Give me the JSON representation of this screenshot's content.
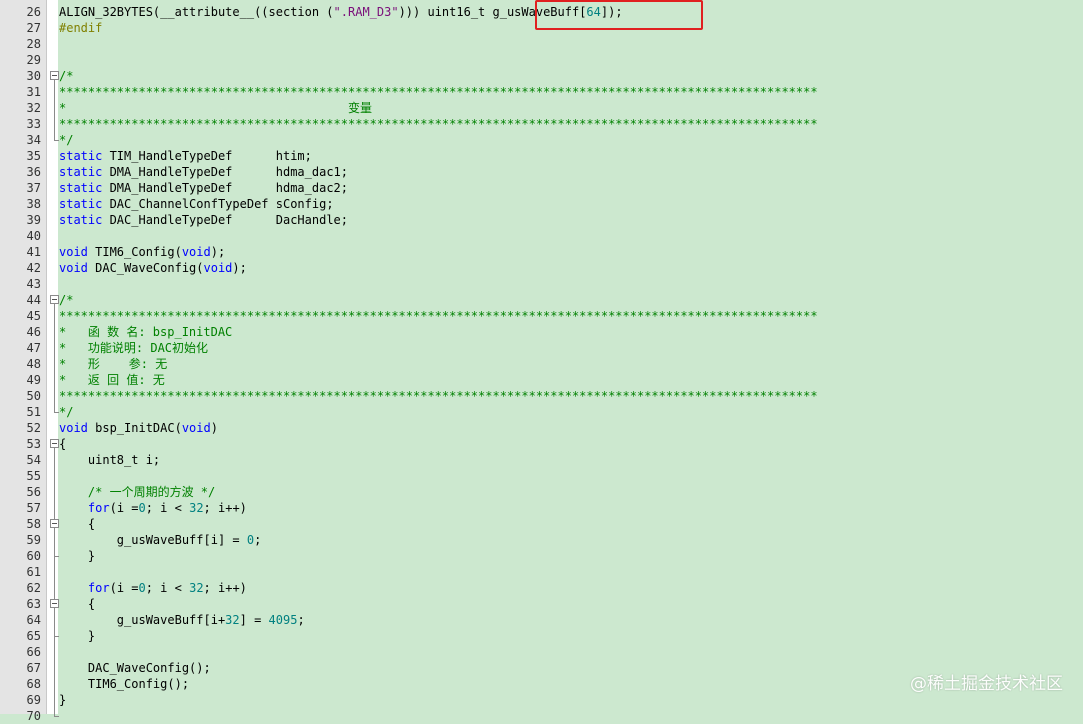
{
  "lines": [
    {
      "n": "26",
      "p": [
        [
          "t",
          "ALIGN_32BYTES(__attribute__((section ("
        ],
        [
          "s",
          "\".RAM_D3\""
        ],
        [
          "t",
          "))) uint16_t g_usWaveBuff["
        ],
        [
          "n",
          "64"
        ],
        [
          "t",
          "]);"
        ]
      ]
    },
    {
      "n": "27",
      "p": [
        [
          "pp",
          "#endif"
        ]
      ]
    },
    {
      "n": "28",
      "p": []
    },
    {
      "n": "29",
      "p": []
    },
    {
      "n": "30",
      "p": [
        [
          "c",
          "/*"
        ]
      ]
    },
    {
      "n": "31",
      "p": [
        [
          "c",
          "*********************************************************************************************************"
        ]
      ]
    },
    {
      "n": "32",
      "p": [
        [
          "c",
          "*                                       变量"
        ]
      ]
    },
    {
      "n": "33",
      "p": [
        [
          "c",
          "*********************************************************************************************************"
        ]
      ]
    },
    {
      "n": "34",
      "p": [
        [
          "c",
          "*/"
        ]
      ]
    },
    {
      "n": "35",
      "p": [
        [
          "k",
          "static"
        ],
        [
          "t",
          " TIM_HandleTypeDef      htim;"
        ]
      ]
    },
    {
      "n": "36",
      "p": [
        [
          "k",
          "static"
        ],
        [
          "t",
          " DMA_HandleTypeDef      hdma_dac1;"
        ]
      ]
    },
    {
      "n": "37",
      "p": [
        [
          "k",
          "static"
        ],
        [
          "t",
          " DMA_HandleTypeDef      hdma_dac2;"
        ]
      ]
    },
    {
      "n": "38",
      "p": [
        [
          "k",
          "static"
        ],
        [
          "t",
          " DAC_ChannelConfTypeDef sConfig;"
        ]
      ]
    },
    {
      "n": "39",
      "p": [
        [
          "k",
          "static"
        ],
        [
          "t",
          " DAC_HandleTypeDef      DacHandle;"
        ]
      ]
    },
    {
      "n": "40",
      "p": []
    },
    {
      "n": "41",
      "p": [
        [
          "k",
          "void"
        ],
        [
          "t",
          " TIM6_Config("
        ],
        [
          "k",
          "void"
        ],
        [
          "t",
          ");"
        ]
      ]
    },
    {
      "n": "42",
      "p": [
        [
          "k",
          "void"
        ],
        [
          "t",
          " DAC_WaveConfig("
        ],
        [
          "k",
          "void"
        ],
        [
          "t",
          ");"
        ]
      ]
    },
    {
      "n": "43",
      "p": []
    },
    {
      "n": "44",
      "p": [
        [
          "c",
          "/*"
        ]
      ]
    },
    {
      "n": "45",
      "p": [
        [
          "c",
          "*********************************************************************************************************"
        ]
      ]
    },
    {
      "n": "46",
      "p": [
        [
          "c",
          "*   函 数 名: bsp_InitDAC"
        ]
      ]
    },
    {
      "n": "47",
      "p": [
        [
          "c",
          "*   功能说明: DAC初始化"
        ]
      ]
    },
    {
      "n": "48",
      "p": [
        [
          "c",
          "*   形    参: 无"
        ]
      ]
    },
    {
      "n": "49",
      "p": [
        [
          "c",
          "*   返 回 值: 无"
        ]
      ]
    },
    {
      "n": "50",
      "p": [
        [
          "c",
          "*********************************************************************************************************"
        ]
      ]
    },
    {
      "n": "51",
      "p": [
        [
          "c",
          "*/"
        ]
      ]
    },
    {
      "n": "52",
      "p": [
        [
          "k",
          "void"
        ],
        [
          "t",
          " bsp_InitDAC("
        ],
        [
          "k",
          "void"
        ],
        [
          "t",
          ")"
        ]
      ]
    },
    {
      "n": "53",
      "p": [
        [
          "t",
          "{"
        ]
      ]
    },
    {
      "n": "54",
      "p": [
        [
          "t",
          "    uint8_t i;"
        ]
      ]
    },
    {
      "n": "55",
      "p": []
    },
    {
      "n": "56",
      "p": [
        [
          "t",
          "    "
        ],
        [
          "c",
          "/* 一个周期的方波 */"
        ]
      ]
    },
    {
      "n": "57",
      "p": [
        [
          "t",
          "    "
        ],
        [
          "k",
          "for"
        ],
        [
          "t",
          "(i ="
        ],
        [
          "n",
          "0"
        ],
        [
          "t",
          "; i < "
        ],
        [
          "n",
          "32"
        ],
        [
          "t",
          "; i++)"
        ]
      ]
    },
    {
      "n": "58",
      "p": [
        [
          "t",
          "    {"
        ]
      ]
    },
    {
      "n": "59",
      "p": [
        [
          "t",
          "        g_usWaveBuff[i] = "
        ],
        [
          "n",
          "0"
        ],
        [
          "t",
          ";"
        ]
      ]
    },
    {
      "n": "60",
      "p": [
        [
          "t",
          "    }"
        ]
      ]
    },
    {
      "n": "61",
      "p": []
    },
    {
      "n": "62",
      "p": [
        [
          "t",
          "    "
        ],
        [
          "k",
          "for"
        ],
        [
          "t",
          "(i ="
        ],
        [
          "n",
          "0"
        ],
        [
          "t",
          "; i < "
        ],
        [
          "n",
          "32"
        ],
        [
          "t",
          "; i++)"
        ]
      ]
    },
    {
      "n": "63",
      "p": [
        [
          "t",
          "    {"
        ]
      ]
    },
    {
      "n": "64",
      "p": [
        [
          "t",
          "        g_usWaveBuff[i+"
        ],
        [
          "n",
          "32"
        ],
        [
          "t",
          "] = "
        ],
        [
          "n",
          "4095"
        ],
        [
          "t",
          ";"
        ]
      ]
    },
    {
      "n": "65",
      "p": [
        [
          "t",
          "    }"
        ]
      ]
    },
    {
      "n": "66",
      "p": []
    },
    {
      "n": "67",
      "p": [
        [
          "t",
          "    DAC_WaveConfig();"
        ]
      ]
    },
    {
      "n": "68",
      "p": [
        [
          "t",
          "    TIM6_Config();"
        ]
      ]
    },
    {
      "n": "69",
      "p": [
        [
          "t",
          "}"
        ]
      ]
    },
    {
      "n": "70",
      "p": []
    }
  ],
  "folds": [
    {
      "line": "30",
      "end": "34"
    },
    {
      "line": "44",
      "end": "51"
    },
    {
      "line": "53",
      "end": "70"
    },
    {
      "line": "58",
      "end": "60"
    },
    {
      "line": "63",
      "end": "65"
    }
  ],
  "colors": {
    "background": "#cce8cf",
    "keyword": "#0000ff",
    "number": "#008080",
    "string": "#7a0f7a",
    "comment": "#008000",
    "preprocessor": "#808000",
    "highlight_box": "#e02020"
  },
  "watermark": "@稀土掘金技术社区"
}
